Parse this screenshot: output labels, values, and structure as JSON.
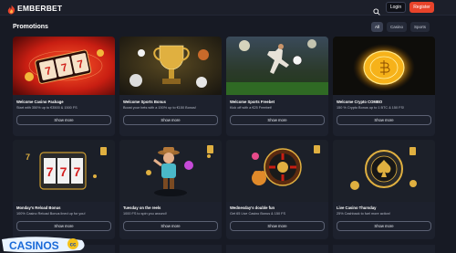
{
  "brand": {
    "name": "EMBERBET"
  },
  "header": {
    "login_label": "Login",
    "register_label": "Register"
  },
  "page": {
    "title": "Promotions"
  },
  "filters": [
    {
      "label": "All",
      "active": true
    },
    {
      "label": "Casino",
      "active": false
    },
    {
      "label": "Sports",
      "active": false
    }
  ],
  "cards": [
    {
      "title": "Welcome Casino Package",
      "desc": "Start with 350% up to €3500 & 1500 FS",
      "button": "Show more",
      "art": "slots"
    },
    {
      "title": "Welcome Sports Bonus",
      "desc": "Boost your bets with a 150% up to €150 Bonus!",
      "button": "Show more",
      "art": "trophy"
    },
    {
      "title": "Welcome Sports Freebet",
      "desc": "Kick off with a €25 Freebet!",
      "button": "Show more",
      "art": "football"
    },
    {
      "title": "Welcome Crypto COMBO",
      "desc": "150 % Crypto Bonus up to 1 BTC & 150 FS!",
      "button": "Show more",
      "art": "coin"
    },
    {
      "title": "Monday's Reload Bonus",
      "desc": "100% Casino Reload Bonus lined up for you!",
      "button": "Show more",
      "art": "777"
    },
    {
      "title": "Tuesday on the reels",
      "desc": "1000 FS to spin you around!",
      "button": "Show more",
      "art": "character"
    },
    {
      "title": "Wednesday's double fun",
      "desc": "Get 65 Live Casino Bonus & 150 FS",
      "button": "Show more",
      "art": "roulette"
    },
    {
      "title": "Live Casino Thursday",
      "desc": "25% Cashback to fuel more action!",
      "button": "Show more",
      "art": "chip"
    }
  ],
  "watermark": {
    "text": "CASINOS",
    "suffix": "cc"
  },
  "colors": {
    "accent": "#e8432a",
    "background": "#171a24",
    "card": "#1d212d"
  }
}
